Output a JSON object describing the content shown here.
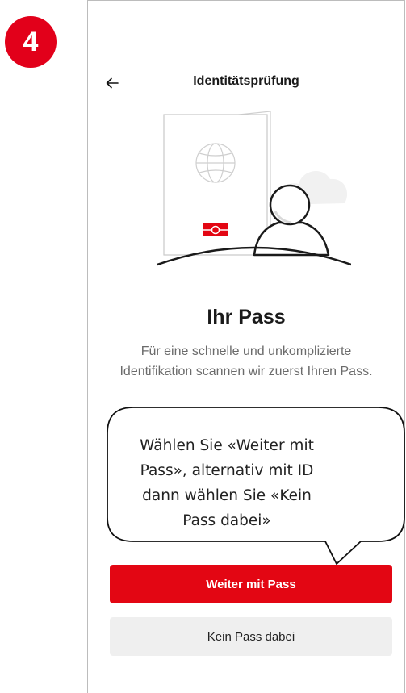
{
  "step_badge": "4",
  "header": {
    "title": "Identitätsprüfung"
  },
  "main": {
    "title": "Ihr Pass",
    "description": "Für eine schnelle und unkomplizierte Identifikation scannen wir zuerst Ihren Pass."
  },
  "callout": {
    "lines": [
      "Wählen Sie «Weiter mit",
      "Pass», alternativ mit ID",
      "dann wählen Sie «Kein",
      "Pass dabei»"
    ]
  },
  "buttons": {
    "primary_label": "Weiter mit Pass",
    "secondary_label": "Kein Pass dabei"
  },
  "colors": {
    "accent": "#e30613",
    "secondary_bg": "#efefef",
    "text": "#1a1a1a",
    "muted_text": "#6b6b6b"
  }
}
